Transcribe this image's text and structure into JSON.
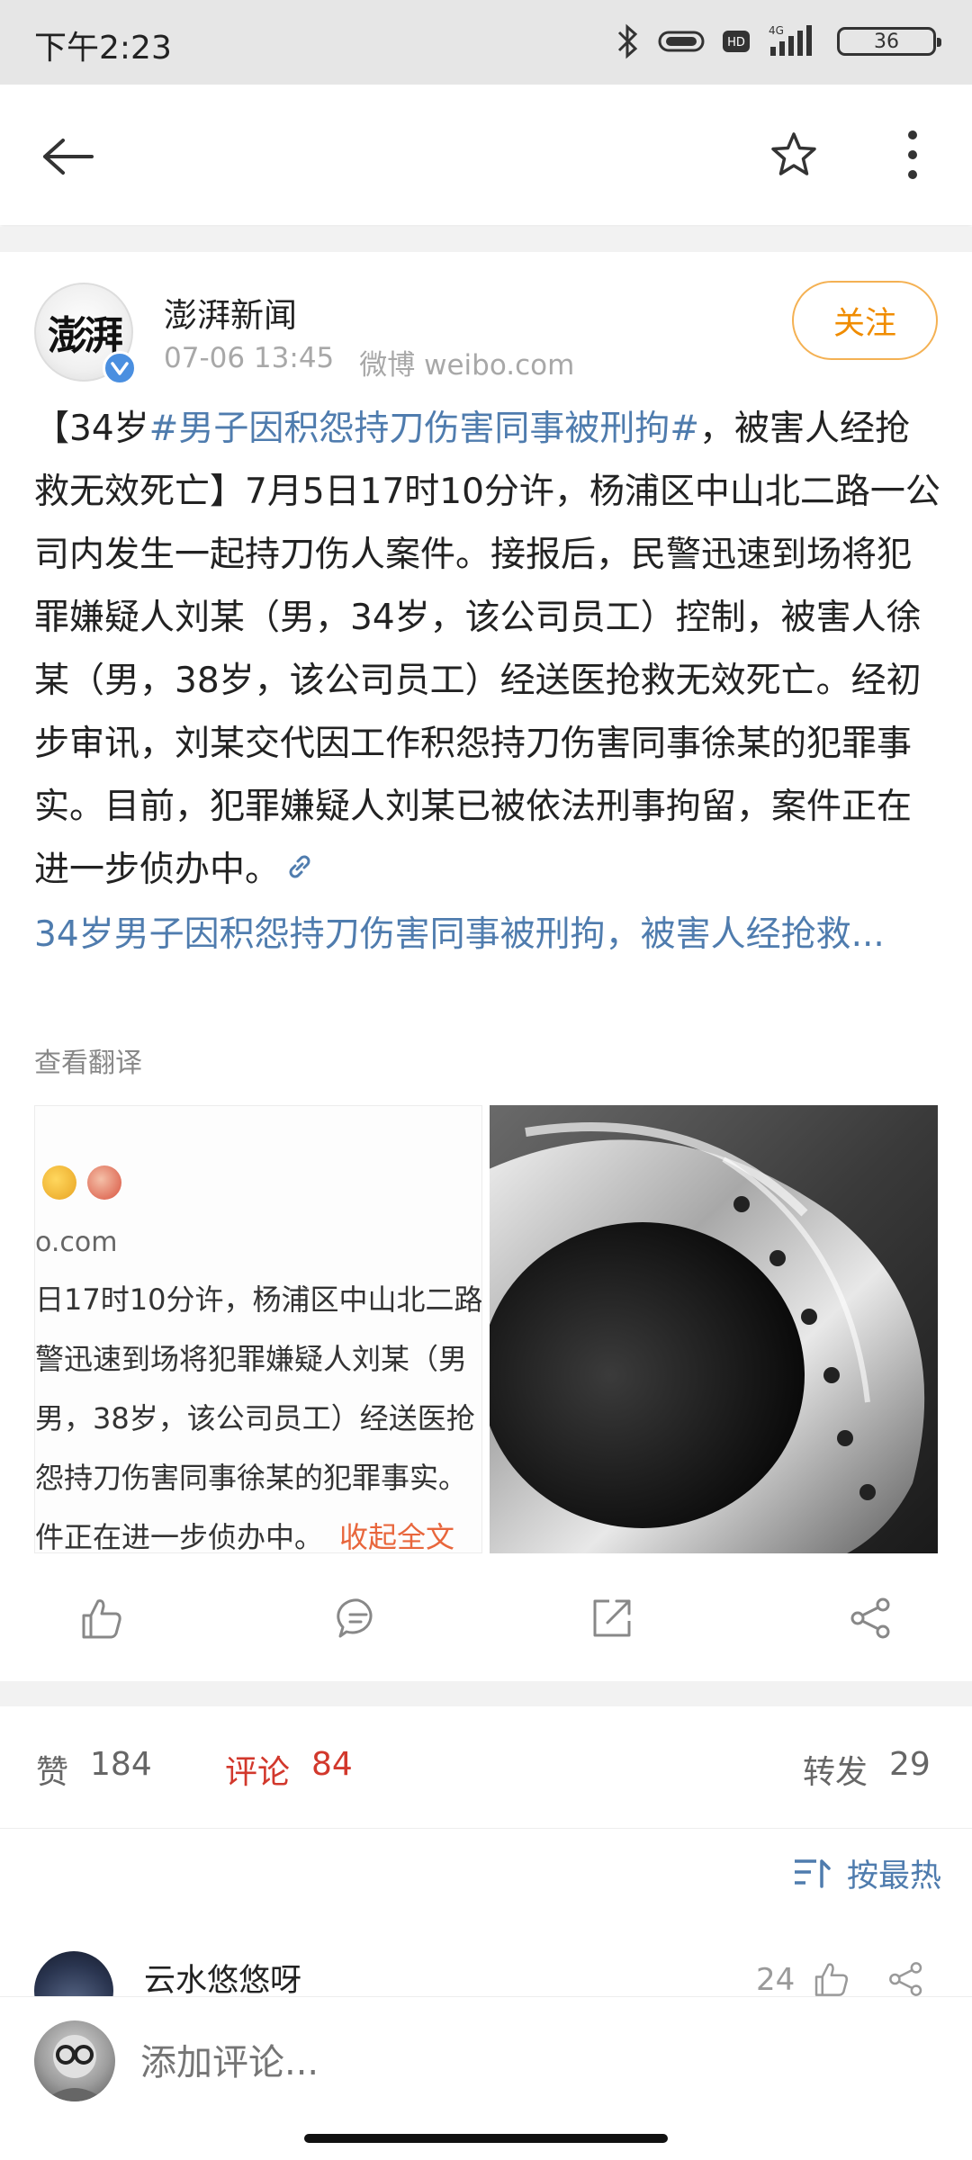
{
  "status_bar": {
    "time": "下午2:23",
    "network": "4G",
    "hd": "HD",
    "battery": "36"
  },
  "nav": {
    "back_icon": "arrow-left-icon",
    "favorite_icon": "star-outline-icon",
    "more_icon": "more-vertical-icon"
  },
  "post": {
    "author": "澎湃新闻",
    "avatar_logo": "澎湃",
    "timestamp": "07-06 13:45",
    "source": "微博 weibo.com",
    "follow_label": "关注",
    "body": {
      "prefix": "【34岁",
      "hashtag": "#男子因积怨持刀伤害同事被刑拘#",
      "main_text": "，被害人经抢救无效死亡】7月5日17时10分许，杨浦区中山北二路一公司内发生一起持刀伤人案件。接报后，民警迅速到场将犯罪嫌疑人刘某（男，34岁，该公司员工）控制，被害人徐某（男，38岁，该公司员工）经送医抢救无效死亡。经初步审讯，刘某交代因工作积怨持刀伤害同事徐某的犯罪事实。目前，犯罪嫌疑人刘某已被依法刑事拘留，案件正在进一步侦办中。",
      "link_text": "34岁男子因积怨持刀伤害同事被刑拘，被害人经抢救..."
    },
    "translate_label": "查看翻译",
    "image_left": {
      "line1": "o.com",
      "line2": "日17时10分许，杨浦区中山北二路",
      "line3": "警迅速到场将犯罪嫌疑人刘某（男",
      "line4": "男，38岁，该公司员工）经送医抢",
      "line5": "怨持刀伤害同事徐某的犯罪事实。",
      "line6": "件正在进一步侦办中。",
      "collapse": "收起全文"
    },
    "actions": [
      "like-icon",
      "comment-icon",
      "repost-icon",
      "share-icon"
    ]
  },
  "stats": {
    "likes_label": "赞",
    "likes_count": "184",
    "comments_label": "评论",
    "comments_count": "84",
    "reposts_label": "转发",
    "reposts_count": "29"
  },
  "sort": {
    "label": "按最热"
  },
  "first_comment": {
    "name": "云水悠悠呀",
    "likes": "24"
  },
  "bottom": {
    "input_placeholder": "添加评论..."
  },
  "colors": {
    "link": "#4f7cae",
    "follow": "#f08c00",
    "active_tab": "#d2382c"
  }
}
